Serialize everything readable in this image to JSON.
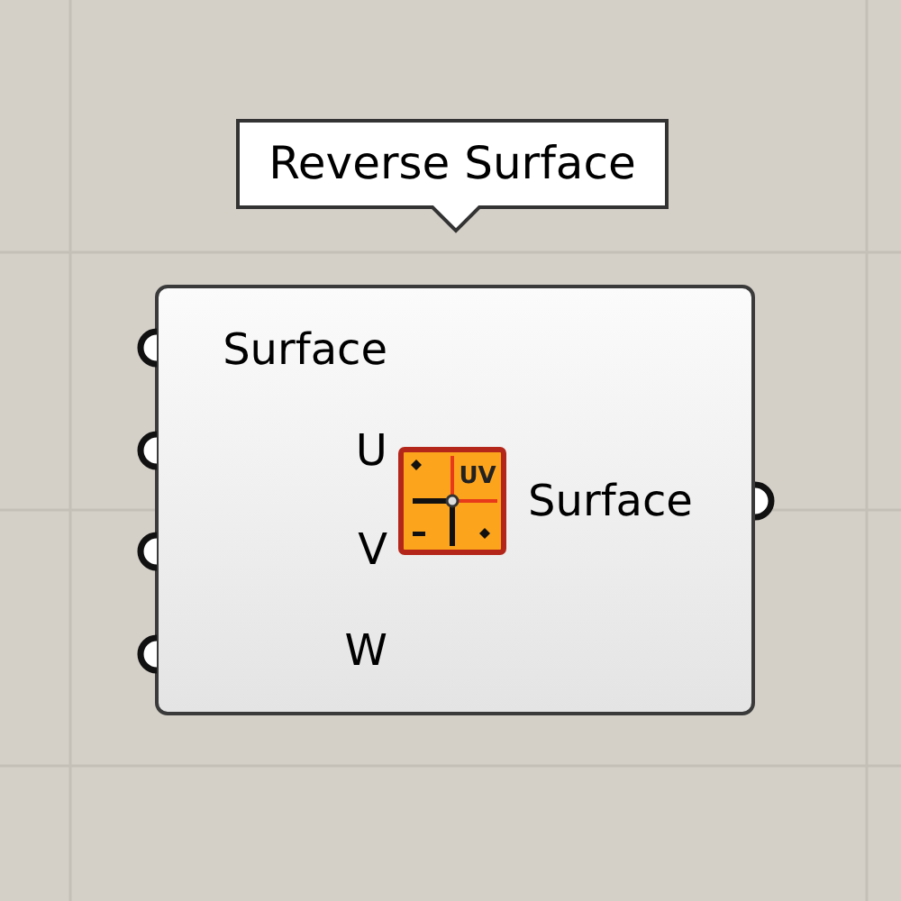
{
  "tooltip": {
    "text": "Reverse Surface"
  },
  "component": {
    "inputs": [
      {
        "label": "Surface"
      },
      {
        "label": "U"
      },
      {
        "label": "V"
      },
      {
        "label": "W"
      }
    ],
    "icon_label": "UV",
    "outputs": [
      {
        "label": "Surface"
      }
    ]
  }
}
